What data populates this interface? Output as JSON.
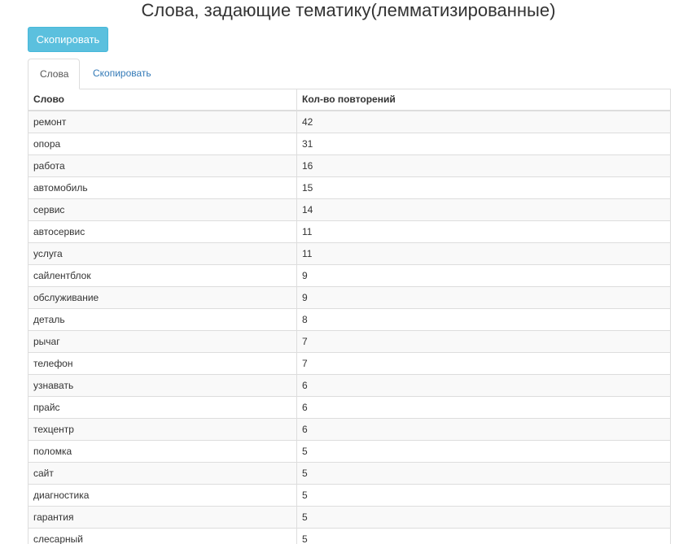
{
  "page": {
    "title": "Слова, задающие тематику(лемматизированные)"
  },
  "toolbar": {
    "copy_label": "Скопировать"
  },
  "tabs": [
    {
      "label": "Слова",
      "active": true
    },
    {
      "label": "Скопировать",
      "active": false
    }
  ],
  "table": {
    "headers": [
      "Слово",
      "Кол-во повторений"
    ],
    "rows": [
      [
        "ремонт",
        "42"
      ],
      [
        "опора",
        "31"
      ],
      [
        "работа",
        "16"
      ],
      [
        "автомобиль",
        "15"
      ],
      [
        "сервис",
        "14"
      ],
      [
        "автосервис",
        "11"
      ],
      [
        "услуга",
        "11"
      ],
      [
        "сайлентблок",
        "9"
      ],
      [
        "обслуживание",
        "9"
      ],
      [
        "деталь",
        "8"
      ],
      [
        "рычаг",
        "7"
      ],
      [
        "телефон",
        "7"
      ],
      [
        "узнавать",
        "6"
      ],
      [
        "прайс",
        "6"
      ],
      [
        "техцентр",
        "6"
      ],
      [
        "поломка",
        "5"
      ],
      [
        "сайт",
        "5"
      ],
      [
        "диагностика",
        "5"
      ],
      [
        "гарантия",
        "5"
      ],
      [
        "слесарный",
        "5"
      ]
    ]
  },
  "colors": {
    "button_bg": "#5bc0de",
    "link": "#337ab7",
    "stripe": "#f9f9f9",
    "border": "#dddddd"
  }
}
